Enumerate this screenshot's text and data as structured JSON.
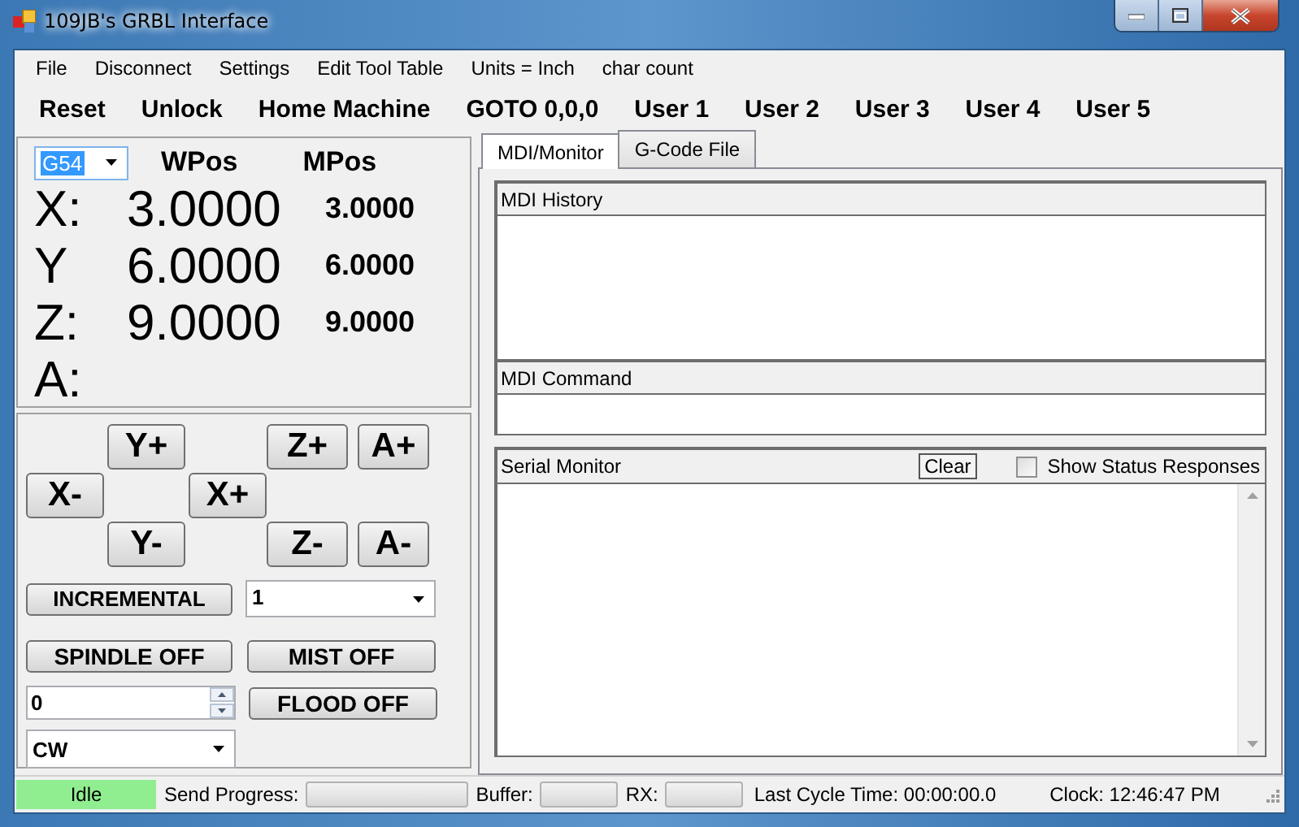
{
  "window": {
    "title": "109JB's GRBL Interface"
  },
  "menu": [
    "File",
    "Disconnect",
    "Settings",
    "Edit Tool Table",
    "Units = Inch",
    "char count"
  ],
  "toolbar": [
    "Reset",
    "Unlock",
    "Home Machine",
    "GOTO 0,0,0",
    "User 1",
    "User 2",
    "User 3",
    "User 4",
    "User 5"
  ],
  "position": {
    "coordinate_system": "G54",
    "headers": [
      "WPos",
      "MPos"
    ],
    "axes": [
      {
        "label": "X:",
        "wpos": "3.0000",
        "mpos": "3.0000"
      },
      {
        "label": "Y",
        "wpos": "6.0000",
        "mpos": "6.0000"
      },
      {
        "label": "Z:",
        "wpos": "9.0000",
        "mpos": "9.0000"
      },
      {
        "label": "A:"
      }
    ]
  },
  "jog": {
    "buttons": [
      "Y+",
      "Z+",
      "A+",
      "X-",
      "X+",
      "Y-",
      "Z-",
      "A-"
    ],
    "mode_button": "INCREMENTAL",
    "step": "1",
    "spindle_button": "SPINDLE OFF",
    "mist_button": "MIST OFF",
    "spindle_speed": "0",
    "flood_button": "FLOOD OFF",
    "direction": "CW"
  },
  "tabs": [
    {
      "label": "MDI/Monitor",
      "selected": true
    },
    {
      "label": "G-Code File",
      "selected": false
    }
  ],
  "mdi_history": {
    "title": "MDI History"
  },
  "mdi_command": {
    "title": "MDI Command"
  },
  "serial_monitor": {
    "title": "Serial Monitor",
    "clear_button": "Clear",
    "show_status": {
      "label": "Show Status Responses",
      "checked": false
    }
  },
  "status_bar": {
    "state": "Idle",
    "send_progress": {
      "label": "Send Progress:",
      "level": 0
    },
    "buffer": {
      "label": "Buffer:",
      "level": 0
    },
    "rx": {
      "label": "RX:",
      "level": 0
    },
    "cycle_time": "Last Cycle Time: 00:00:00.0",
    "clock": "Clock: 12:46:47 PM"
  }
}
